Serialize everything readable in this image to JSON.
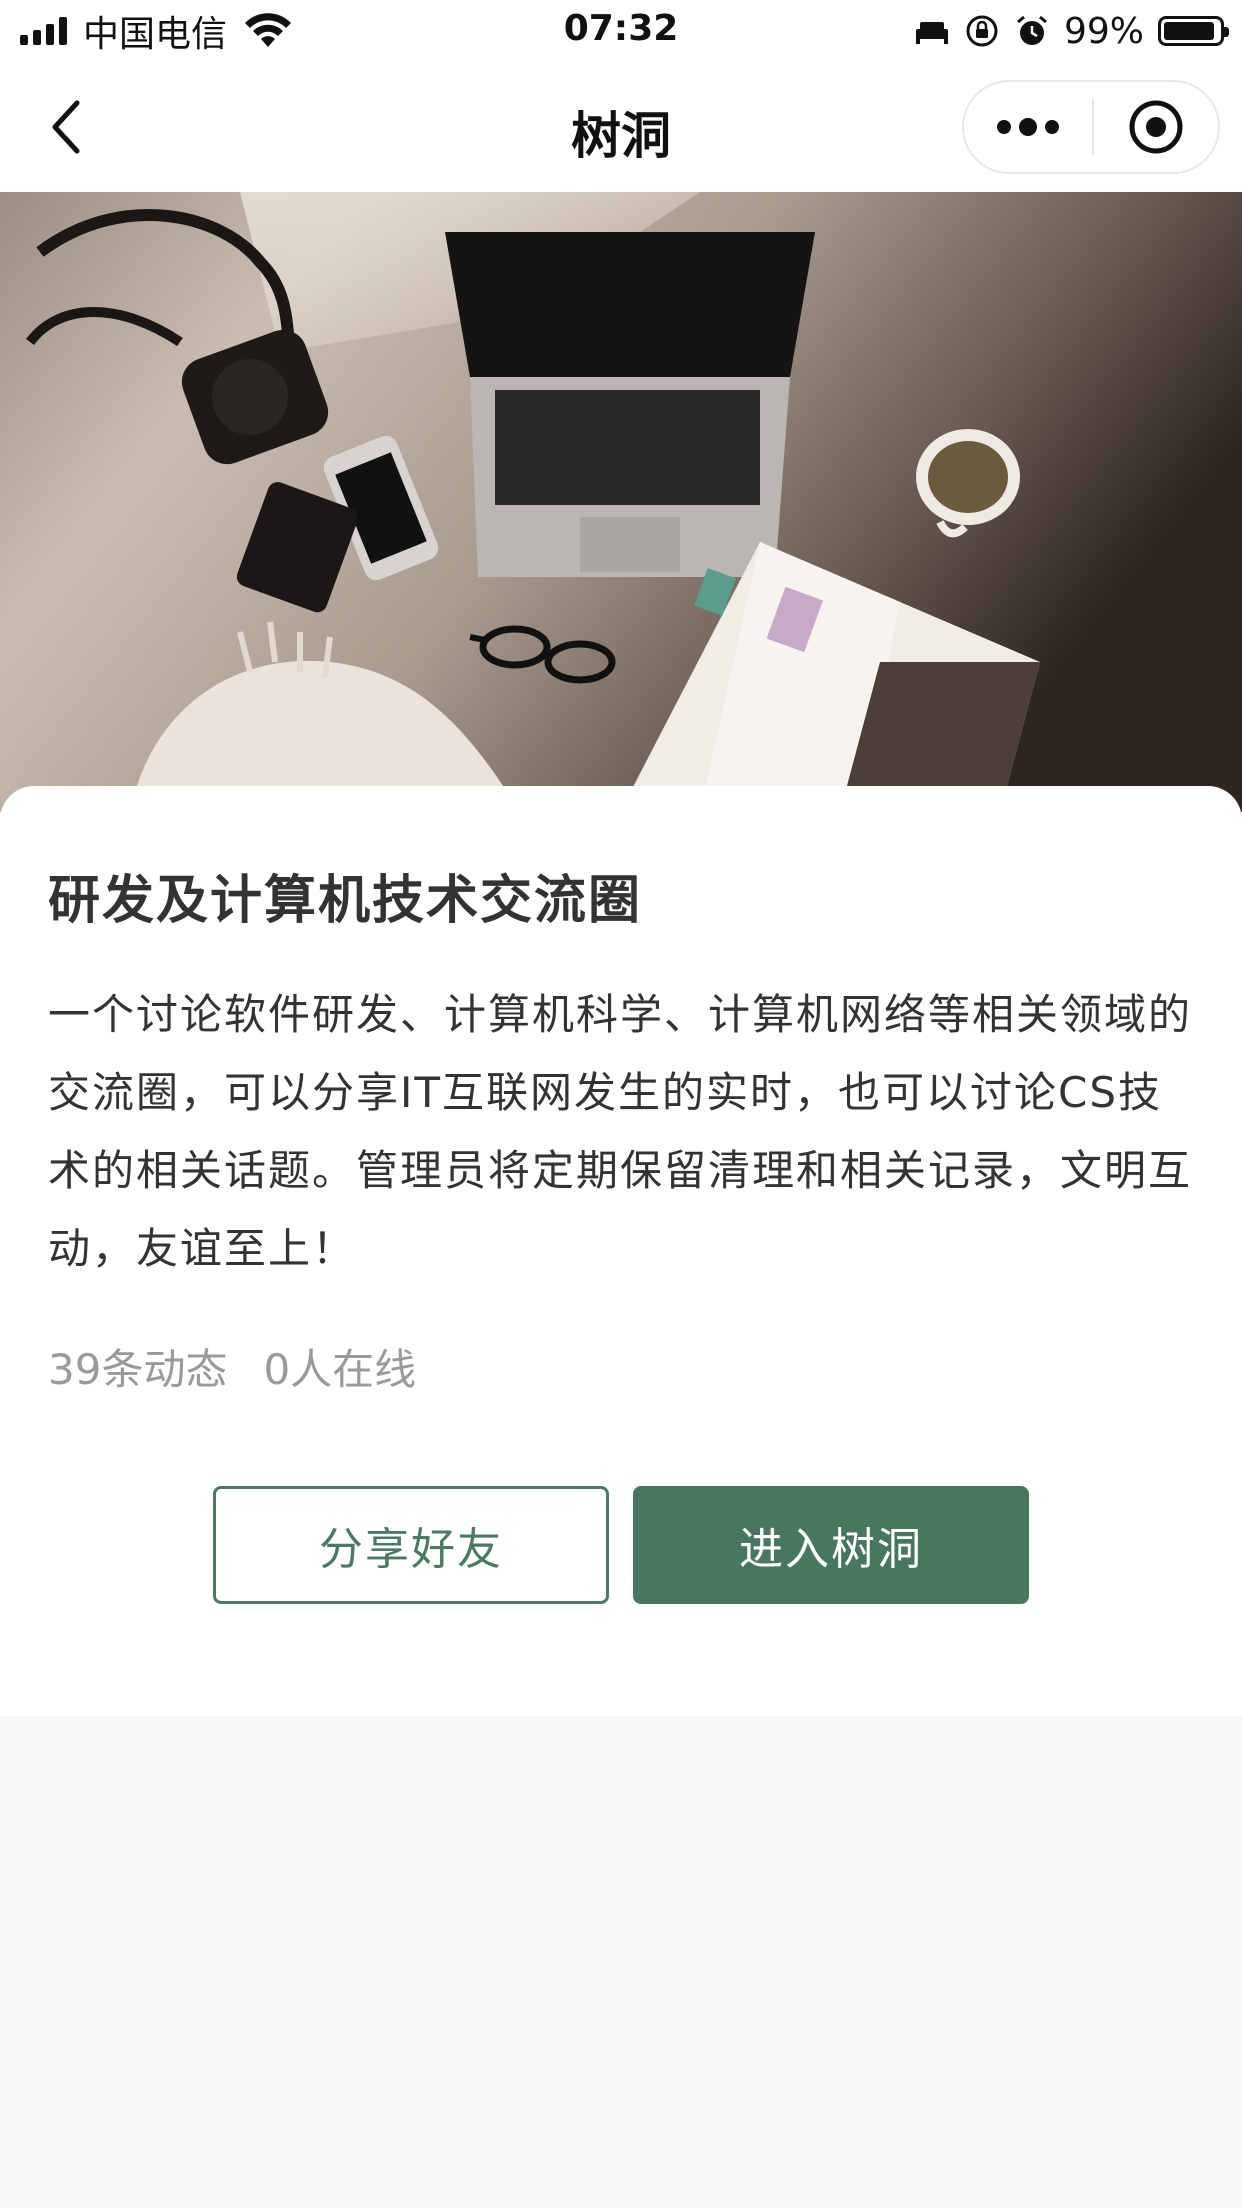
{
  "status_bar": {
    "carrier": "中国电信",
    "time": "07:32",
    "battery": "99%",
    "icons": [
      "signal-icon",
      "wifi-icon",
      "bed-icon",
      "orientation-lock-icon",
      "alarm-icon",
      "battery-icon"
    ]
  },
  "nav": {
    "title": "树洞",
    "icons": [
      "back-chevron-icon",
      "more-dots-icon",
      "close-target-icon"
    ]
  },
  "hero": {
    "scene": "desk-flatlay"
  },
  "circle": {
    "title": "研发及计算机技术交流圈",
    "description": "一个讨论软件研发、计算机科学、计算机网络等相关领域的交流圈，可以分享IT互联网发生的实时，也可以讨论CS技术的相关话题。管理员将定期保留清理和相关记录，文明互动，友谊至上！",
    "posts": "39条动态",
    "online": "0人在线"
  },
  "actions": {
    "share_label": "分享好友",
    "enter_label": "进入树洞"
  },
  "colors": {
    "accent": "#47775f",
    "background": "#f6f6f6",
    "stats_text": "#9a9a9a"
  }
}
